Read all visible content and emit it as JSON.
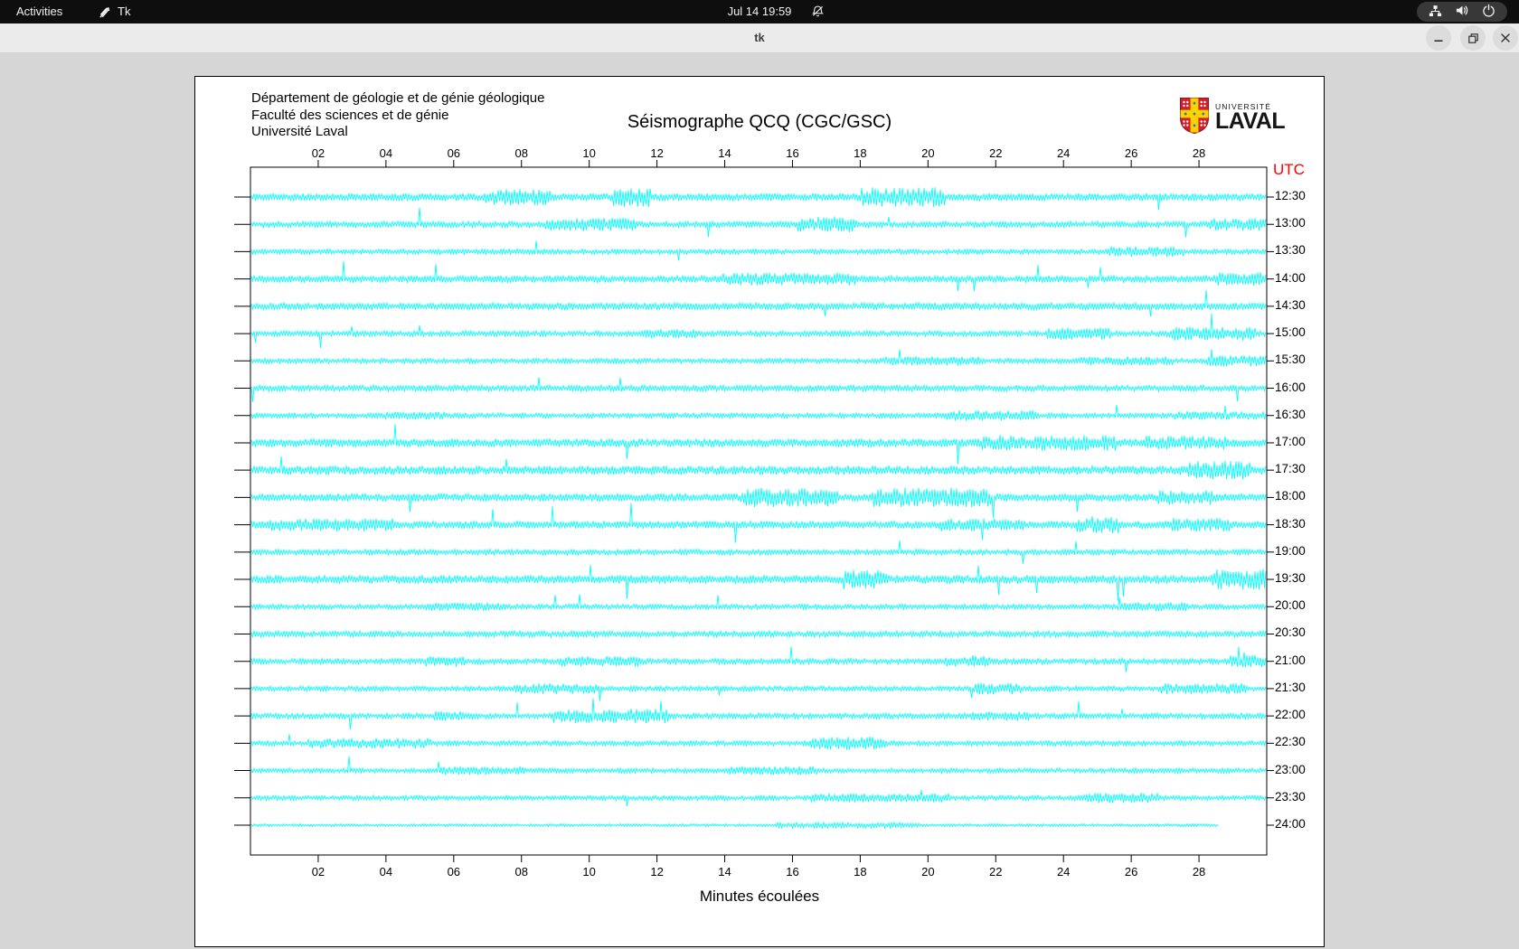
{
  "topbar": {
    "activities": "Activities",
    "app_name": "Tk",
    "clock": "Jul 14 19:59",
    "icons": [
      "tk-feather-icon",
      "notifications-muted-icon",
      "network-wired-icon",
      "volume-icon",
      "power-icon"
    ]
  },
  "titlebar": {
    "title": "tk",
    "buttons": [
      "minimize",
      "maximize",
      "close"
    ]
  },
  "panel": {
    "header_lines": [
      "Département de géologie et de génie géologique",
      "Faculté des sciences et de génie",
      "Université Laval"
    ],
    "title": "Séismographe QCQ (CGC/GSC)",
    "logo": {
      "line1": "UNIVERSITÉ",
      "line2": "LAVAL"
    },
    "utc_label": "UTC",
    "xlabel": "Minutes écoulées",
    "colors": {
      "trace": "#00ffff",
      "utc": "#ff0000",
      "axis": "#000000"
    }
  },
  "chart": {
    "type": "seismogram-helicorder",
    "station": "QCQ (CGC/GSC)",
    "x_range_minutes": [
      0,
      30
    ],
    "x_ticks": [
      "02",
      "04",
      "06",
      "08",
      "10",
      "12",
      "14",
      "16",
      "18",
      "20",
      "22",
      "24",
      "26",
      "28"
    ],
    "traces": [
      {
        "label": "12:30",
        "amp": 3.0,
        "sp": 0.006,
        "end": 30
      },
      {
        "label": "13:00",
        "amp": 2.4,
        "sp": 0.005,
        "end": 30
      },
      {
        "label": "13:30",
        "amp": 2.0,
        "sp": 0.005,
        "end": 30
      },
      {
        "label": "14:00",
        "amp": 2.6,
        "sp": 0.006,
        "end": 30
      },
      {
        "label": "14:30",
        "amp": 2.8,
        "sp": 0.006,
        "end": 30
      },
      {
        "label": "15:00",
        "amp": 2.2,
        "sp": 0.005,
        "end": 30
      },
      {
        "label": "15:30",
        "amp": 2.0,
        "sp": 0.004,
        "end": 30
      },
      {
        "label": "16:00",
        "amp": 2.4,
        "sp": 0.005,
        "end": 30
      },
      {
        "label": "16:30",
        "amp": 2.0,
        "sp": 0.005,
        "end": 30
      },
      {
        "label": "17:00",
        "amp": 3.4,
        "sp": 0.006,
        "end": 30
      },
      {
        "label": "17:30",
        "amp": 3.6,
        "sp": 0.006,
        "end": 30
      },
      {
        "label": "18:00",
        "amp": 3.2,
        "sp": 0.006,
        "end": 30
      },
      {
        "label": "18:30",
        "amp": 3.0,
        "sp": 0.006,
        "end": 30
      },
      {
        "label": "19:00",
        "amp": 2.2,
        "sp": 0.005,
        "end": 30
      },
      {
        "label": "19:30",
        "amp": 3.4,
        "sp": 0.005,
        "end": 30
      },
      {
        "label": "20:00",
        "amp": 2.0,
        "sp": 0.005,
        "end": 30
      },
      {
        "label": "20:30",
        "amp": 2.4,
        "sp": 0.006,
        "end": 30
      },
      {
        "label": "21:00",
        "amp": 2.2,
        "sp": 0.006,
        "end": 30
      },
      {
        "label": "21:30",
        "amp": 2.0,
        "sp": 0.005,
        "end": 30
      },
      {
        "label": "22:00",
        "amp": 2.2,
        "sp": 0.005,
        "end": 30
      },
      {
        "label": "22:30",
        "amp": 2.0,
        "sp": 0.004,
        "end": 30
      },
      {
        "label": "23:00",
        "amp": 1.9,
        "sp": 0.004,
        "end": 30
      },
      {
        "label": "23:30",
        "amp": 1.9,
        "sp": 0.004,
        "end": 30
      },
      {
        "label": "24:00",
        "amp": 1.1,
        "sp": 0.0018,
        "end": 28.6
      }
    ]
  }
}
